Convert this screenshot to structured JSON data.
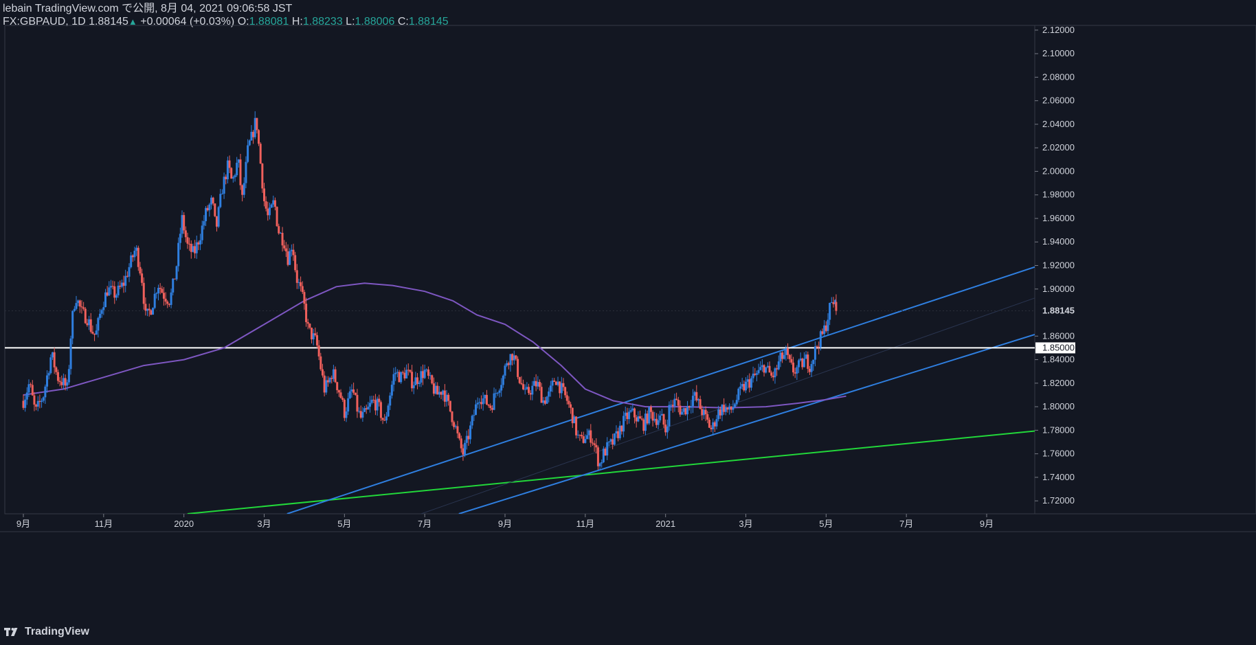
{
  "header": {
    "line1": "lebain TradingView.com で公開, 8月 04, 2021 09:06:58 JST",
    "symbol": "FX:GBPAUD, 1D 1.88145",
    "change_arrow": "▲",
    "change": "+0.00064 (+0.03%)",
    "o_label": "O:",
    "o_val": "1.88081",
    "h_label": "H:",
    "h_val": "1.88233",
    "l_label": "L:",
    "l_val": "1.88006",
    "c_label": "C:",
    "c_val": "1.88145"
  },
  "footer": {
    "brand": "TradingView",
    "logo_icon": "tradingview-logo-icon"
  },
  "colors": {
    "background": "#131722",
    "up": "#2f7fe0",
    "down": "#f0605c",
    "ma": "#7e57c2",
    "channel": "#2f7fe0",
    "support": "#22d83a",
    "level": "#ffffff",
    "last_price_bg": "#131722"
  },
  "chart_data": {
    "type": "candlestick",
    "symbol": "FX:GBPAUD",
    "timeframe": "1D",
    "ylim": [
      1.709,
      2.124
    ],
    "y_ticks": [
      "2.12000",
      "2.10000",
      "2.08000",
      "2.06000",
      "2.04000",
      "2.02000",
      "2.00000",
      "1.98000",
      "1.96000",
      "1.94000",
      "1.92000",
      "1.90000",
      "1.86000",
      "1.84000",
      "1.82000",
      "1.80000",
      "1.78000",
      "1.76000",
      "1.74000",
      "1.72000"
    ],
    "y_tick_values": [
      2.12,
      2.1,
      2.08,
      2.06,
      2.04,
      2.02,
      2.0,
      1.98,
      1.96,
      1.94,
      1.92,
      1.9,
      1.86,
      1.84,
      1.82,
      1.8,
      1.78,
      1.76,
      1.74,
      1.72
    ],
    "x_ticks": [
      "9月",
      "11月",
      "2020",
      "3月",
      "5月",
      "7月",
      "9月",
      "11月",
      "2021",
      "3月",
      "5月",
      "7月",
      "9月"
    ],
    "x_tick_months": [
      0,
      2,
      4,
      6,
      8,
      10,
      12,
      14,
      16,
      18,
      20,
      22,
      24
    ],
    "start_label": "2019-08",
    "last_price": "1.88145",
    "last_price_value": 1.88145,
    "horizontal_level": {
      "value": 1.85,
      "label": "1.85000"
    },
    "price_path": [
      [
        0.0,
        1.805
      ],
      [
        0.15,
        1.82
      ],
      [
        0.3,
        1.795
      ],
      [
        0.5,
        1.81
      ],
      [
        0.7,
        1.845
      ],
      [
        0.85,
        1.825
      ],
      [
        1.0,
        1.82
      ],
      [
        1.1,
        1.815
      ],
      [
        1.2,
        1.87
      ],
      [
        1.3,
        1.895
      ],
      [
        1.45,
        1.88
      ],
      [
        1.6,
        1.875
      ],
      [
        1.7,
        1.865
      ],
      [
        1.8,
        1.86
      ],
      [
        1.95,
        1.885
      ],
      [
        2.1,
        1.9
      ],
      [
        2.3,
        1.895
      ],
      [
        2.5,
        1.905
      ],
      [
        2.65,
        1.92
      ],
      [
        2.8,
        1.935
      ],
      [
        2.95,
        1.91
      ],
      [
        3.05,
        1.875
      ],
      [
        3.2,
        1.885
      ],
      [
        3.35,
        1.905
      ],
      [
        3.5,
        1.895
      ],
      [
        3.65,
        1.89
      ],
      [
        3.8,
        1.915
      ],
      [
        3.95,
        1.96
      ],
      [
        4.1,
        1.935
      ],
      [
        4.25,
        1.93
      ],
      [
        4.4,
        1.945
      ],
      [
        4.55,
        1.965
      ],
      [
        4.7,
        1.975
      ],
      [
        4.8,
        1.95
      ],
      [
        4.95,
        1.985
      ],
      [
        5.1,
        2.005
      ],
      [
        5.2,
        1.99
      ],
      [
        5.35,
        2.01
      ],
      [
        5.45,
        1.975
      ],
      [
        5.6,
        2.02
      ],
      [
        5.7,
        2.03
      ],
      [
        5.8,
        2.045
      ],
      [
        5.9,
        2.01
      ],
      [
        6.0,
        1.975
      ],
      [
        6.1,
        1.96
      ],
      [
        6.25,
        1.975
      ],
      [
        6.35,
        1.95
      ],
      [
        6.5,
        1.94
      ],
      [
        6.6,
        1.925
      ],
      [
        6.7,
        1.94
      ],
      [
        6.8,
        1.91
      ],
      [
        6.9,
        1.9
      ],
      [
        7.0,
        1.885
      ],
      [
        7.1,
        1.865
      ],
      [
        7.2,
        1.86
      ],
      [
        7.3,
        1.855
      ],
      [
        7.4,
        1.835
      ],
      [
        7.5,
        1.815
      ],
      [
        7.6,
        1.82
      ],
      [
        7.7,
        1.83
      ],
      [
        7.8,
        1.82
      ],
      [
        7.9,
        1.81
      ],
      [
        8.0,
        1.795
      ],
      [
        8.1,
        1.805
      ],
      [
        8.2,
        1.815
      ],
      [
        8.3,
        1.8
      ],
      [
        8.4,
        1.79
      ],
      [
        8.55,
        1.795
      ],
      [
        8.7,
        1.805
      ],
      [
        8.85,
        1.8
      ],
      [
        9.0,
        1.785
      ],
      [
        9.1,
        1.805
      ],
      [
        9.25,
        1.83
      ],
      [
        9.4,
        1.825
      ],
      [
        9.55,
        1.83
      ],
      [
        9.7,
        1.82
      ],
      [
        9.85,
        1.825
      ],
      [
        10.0,
        1.83
      ],
      [
        10.15,
        1.82
      ],
      [
        10.3,
        1.81
      ],
      [
        10.45,
        1.815
      ],
      [
        10.6,
        1.8
      ],
      [
        10.75,
        1.785
      ],
      [
        10.85,
        1.77
      ],
      [
        10.95,
        1.76
      ],
      [
        11.05,
        1.77
      ],
      [
        11.2,
        1.79
      ],
      [
        11.35,
        1.81
      ],
      [
        11.5,
        1.805
      ],
      [
        11.65,
        1.8
      ],
      [
        11.8,
        1.815
      ],
      [
        11.95,
        1.825
      ],
      [
        12.05,
        1.84
      ],
      [
        12.2,
        1.845
      ],
      [
        12.35,
        1.825
      ],
      [
        12.5,
        1.81
      ],
      [
        12.65,
        1.815
      ],
      [
        12.8,
        1.82
      ],
      [
        12.95,
        1.805
      ],
      [
        13.1,
        1.81
      ],
      [
        13.25,
        1.825
      ],
      [
        13.4,
        1.815
      ],
      [
        13.55,
        1.805
      ],
      [
        13.7,
        1.79
      ],
      [
        13.8,
        1.775
      ],
      [
        13.9,
        1.77
      ],
      [
        14.0,
        1.775
      ],
      [
        14.15,
        1.775
      ],
      [
        14.25,
        1.765
      ],
      [
        14.35,
        1.75
      ],
      [
        14.45,
        1.76
      ],
      [
        14.55,
        1.765
      ],
      [
        14.7,
        1.77
      ],
      [
        14.85,
        1.78
      ],
      [
        15.0,
        1.79
      ],
      [
        15.15,
        1.795
      ],
      [
        15.3,
        1.79
      ],
      [
        15.45,
        1.785
      ],
      [
        15.6,
        1.795
      ],
      [
        15.75,
        1.79
      ],
      [
        15.9,
        1.79
      ],
      [
        16.0,
        1.78
      ],
      [
        16.1,
        1.8
      ],
      [
        16.25,
        1.805
      ],
      [
        16.4,
        1.795
      ],
      [
        16.55,
        1.8
      ],
      [
        16.7,
        1.81
      ],
      [
        16.85,
        1.8
      ],
      [
        17.0,
        1.79
      ],
      [
        17.15,
        1.78
      ],
      [
        17.3,
        1.795
      ],
      [
        17.45,
        1.8
      ],
      [
        17.6,
        1.795
      ],
      [
        17.75,
        1.805
      ],
      [
        17.9,
        1.815
      ],
      [
        18.05,
        1.82
      ],
      [
        18.2,
        1.825
      ],
      [
        18.35,
        1.83
      ],
      [
        18.45,
        1.835
      ],
      [
        18.55,
        1.83
      ],
      [
        18.65,
        1.825
      ],
      [
        18.75,
        1.83
      ],
      [
        18.85,
        1.84
      ],
      [
        19.0,
        1.845
      ],
      [
        19.1,
        1.835
      ],
      [
        19.2,
        1.83
      ],
      [
        19.35,
        1.835
      ],
      [
        19.5,
        1.84
      ],
      [
        19.6,
        1.835
      ],
      [
        19.7,
        1.845
      ],
      [
        19.8,
        1.855
      ],
      [
        19.9,
        1.86
      ],
      [
        20.0,
        1.87
      ],
      [
        20.1,
        1.885
      ],
      [
        20.2,
        1.89
      ],
      [
        20.25,
        1.882
      ]
    ],
    "ma_path": [
      [
        0.0,
        1.81
      ],
      [
        1.0,
        1.815
      ],
      [
        2.0,
        1.825
      ],
      [
        3.0,
        1.835
      ],
      [
        4.0,
        1.84
      ],
      [
        5.0,
        1.85
      ],
      [
        6.0,
        1.87
      ],
      [
        7.0,
        1.89
      ],
      [
        7.8,
        1.902
      ],
      [
        8.5,
        1.905
      ],
      [
        9.2,
        1.903
      ],
      [
        10.0,
        1.898
      ],
      [
        10.7,
        1.89
      ],
      [
        11.3,
        1.878
      ],
      [
        12.0,
        1.87
      ],
      [
        12.7,
        1.855
      ],
      [
        13.4,
        1.835
      ],
      [
        14.0,
        1.815
      ],
      [
        14.7,
        1.805
      ],
      [
        15.5,
        1.8
      ],
      [
        16.5,
        1.8
      ],
      [
        17.5,
        1.799
      ],
      [
        18.5,
        1.8
      ],
      [
        19.3,
        1.803
      ],
      [
        20.0,
        1.806
      ],
      [
        20.5,
        1.809
      ]
    ],
    "overlays": {
      "channel_upper": [
        [
          6.57,
          1.709
        ],
        [
          23.0,
          1.894
        ]
      ],
      "channel_lower": [
        [
          10.85,
          1.709
        ],
        [
          23.0,
          1.838
        ]
      ],
      "support_line": [
        [
          4.09,
          1.709
        ],
        [
          23.0,
          1.772
        ]
      ]
    }
  }
}
